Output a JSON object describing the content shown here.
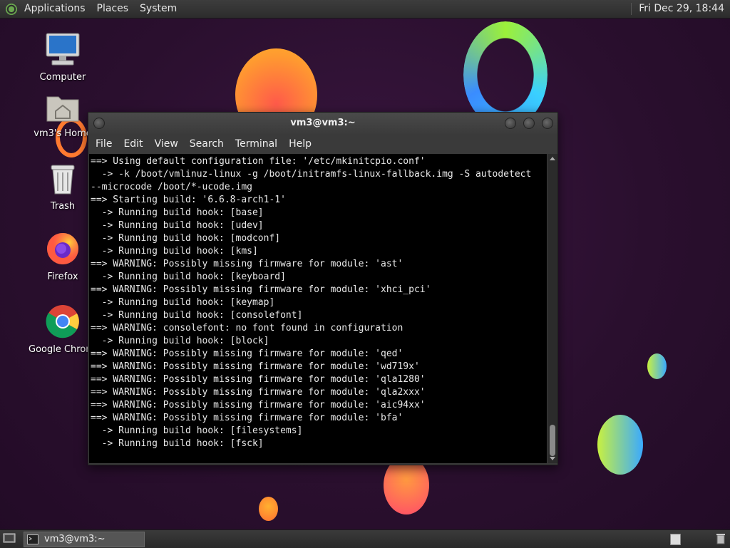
{
  "top_panel": {
    "menus": [
      "Applications",
      "Places",
      "System"
    ],
    "clock": "Fri Dec 29, 18:44"
  },
  "desktop": {
    "icons": [
      {
        "label": "Computer",
        "icon": "computer-icon"
      },
      {
        "label": "vm3's Home",
        "icon": "home-folder-icon"
      },
      {
        "label": "Trash",
        "icon": "trash-icon"
      },
      {
        "label": "Firefox",
        "icon": "firefox-icon"
      },
      {
        "label": "Google Chrome",
        "icon": "chrome-icon"
      }
    ]
  },
  "terminal": {
    "title": "vm3@vm3:~",
    "menu": [
      "File",
      "Edit",
      "View",
      "Search",
      "Terminal",
      "Help"
    ],
    "lines": [
      "==> Using default configuration file: '/etc/mkinitcpio.conf'",
      "  -> -k /boot/vmlinuz-linux -g /boot/initramfs-linux-fallback.img -S autodetect",
      "--microcode /boot/*-ucode.img",
      "==> Starting build: '6.6.8-arch1-1'",
      "  -> Running build hook: [base]",
      "  -> Running build hook: [udev]",
      "  -> Running build hook: [modconf]",
      "  -> Running build hook: [kms]",
      "==> WARNING: Possibly missing firmware for module: 'ast'",
      "  -> Running build hook: [keyboard]",
      "==> WARNING: Possibly missing firmware for module: 'xhci_pci'",
      "  -> Running build hook: [keymap]",
      "  -> Running build hook: [consolefont]",
      "==> WARNING: consolefont: no font found in configuration",
      "  -> Running build hook: [block]",
      "==> WARNING: Possibly missing firmware for module: 'qed'",
      "==> WARNING: Possibly missing firmware for module: 'wd719x'",
      "==> WARNING: Possibly missing firmware for module: 'qla1280'",
      "==> WARNING: Possibly missing firmware for module: 'qla2xxx'",
      "==> WARNING: Possibly missing firmware for module: 'aic94xx'",
      "==> WARNING: Possibly missing firmware for module: 'bfa'",
      "  -> Running build hook: [filesystems]",
      "  -> Running build hook: [fsck]"
    ]
  },
  "bottom_panel": {
    "task_label": "vm3@vm3:~"
  }
}
